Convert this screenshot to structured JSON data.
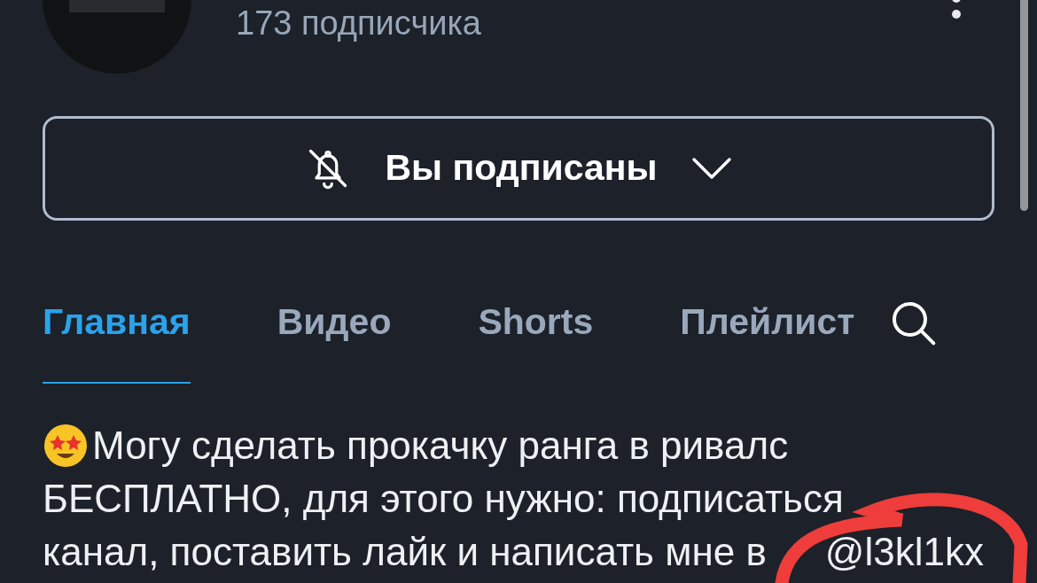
{
  "channel": {
    "subscribers": "173 подписчика"
  },
  "subscribe_button": {
    "label": "Вы подписаны",
    "notifications_on": false
  },
  "tabs": [
    {
      "label": "Главная",
      "selected": true
    },
    {
      "label": "Видео",
      "selected": false
    },
    {
      "label": "Shorts",
      "selected": false
    },
    {
      "label": "Плейлист",
      "selected": false
    }
  ],
  "description": {
    "lines": [
      "Могу сделать прокачку ранга в ривалс",
      "БЕСПЛАТНО, для этого нужно: подписаться",
      "канал, поставить лайк и написать мне в"
    ],
    "handle": "@l3kl1kx"
  }
}
